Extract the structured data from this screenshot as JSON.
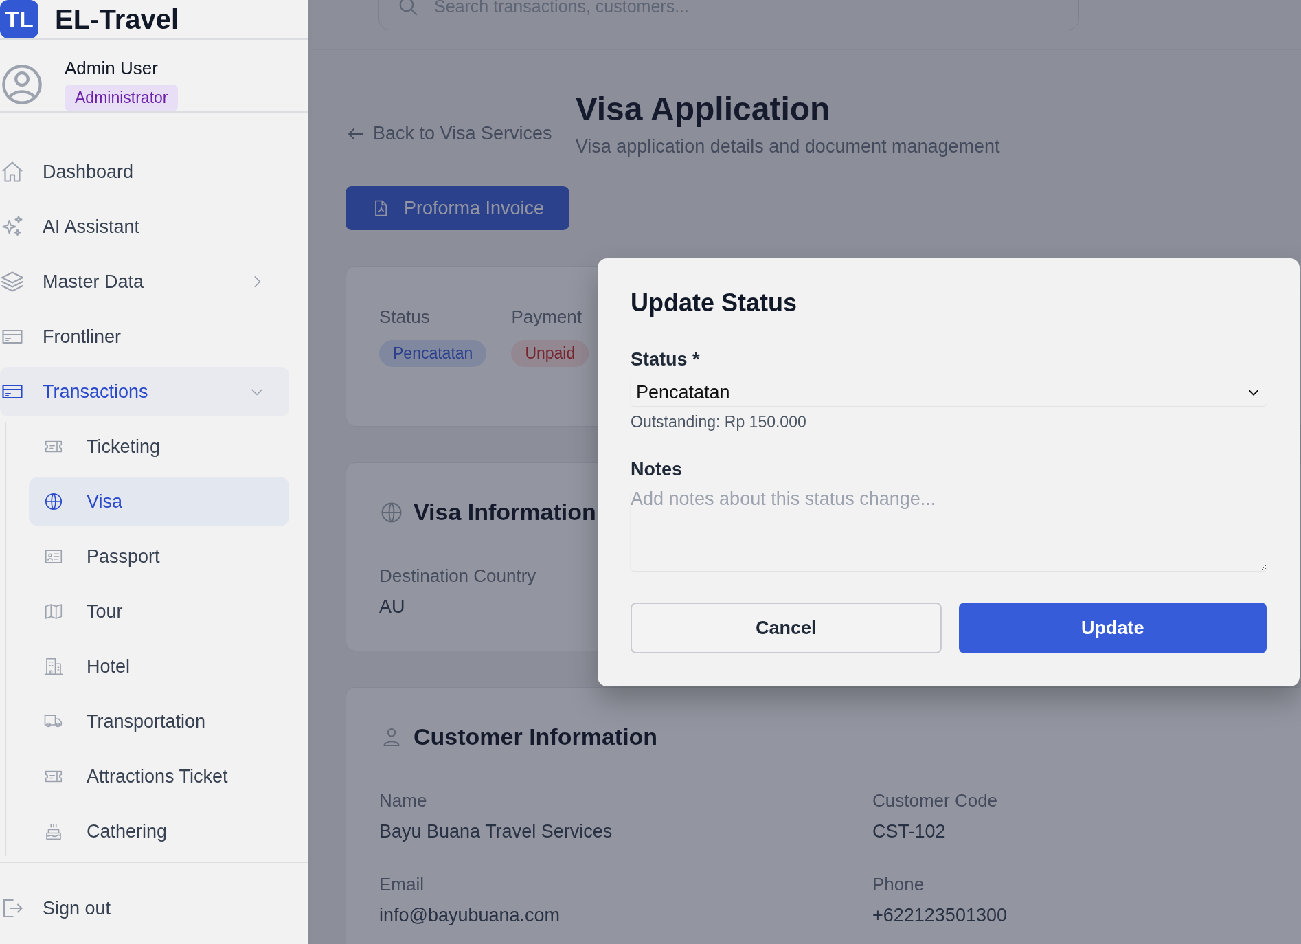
{
  "brand": {
    "logo": "TL",
    "name": "EL-Travel"
  },
  "user": {
    "name": "Admin User",
    "role": "Administrator"
  },
  "sidebar": {
    "items": [
      {
        "label": "Dashboard",
        "selected": false
      },
      {
        "label": "AI Assistant",
        "selected": false
      },
      {
        "label": "Master Data",
        "selected": false,
        "expanded": false
      },
      {
        "label": "Frontliner",
        "selected": false
      },
      {
        "label": "Transactions",
        "selected": false,
        "expanded": true,
        "children": [
          {
            "label": "Ticketing",
            "selected": false
          },
          {
            "label": "Visa",
            "selected": true
          },
          {
            "label": "Passport",
            "selected": false
          },
          {
            "label": "Tour",
            "selected": false
          },
          {
            "label": "Hotel",
            "selected": false
          },
          {
            "label": "Transportation",
            "selected": false
          },
          {
            "label": "Attractions Ticket",
            "selected": false
          },
          {
            "label": "Cathering",
            "selected": false
          }
        ]
      }
    ],
    "sign_out": "Sign out"
  },
  "search": {
    "placeholder": "Search transactions, customers..."
  },
  "page": {
    "back_link": "Back to Visa Services",
    "title": "Visa Application",
    "subtitle": "Visa application details and document management",
    "action": "Proforma Invoice",
    "badges": [
      {
        "label": "Status",
        "value": "Pencatatan",
        "kind": "info"
      },
      {
        "label": "Payment",
        "value": "Unpaid",
        "kind": "danger"
      }
    ],
    "visa_info": {
      "title": "Visa Information",
      "fields": [
        {
          "label": "Destination Country",
          "value": "AU"
        }
      ]
    },
    "customer_info": {
      "title": "Customer Information",
      "fields": [
        {
          "label": "Name",
          "value": "Bayu Buana Travel Services"
        },
        {
          "label": "Customer Code",
          "value": "CST-102"
        },
        {
          "label": "Email",
          "value": "info@bayubuana.com"
        },
        {
          "label": "Phone",
          "value": "+622123501300"
        }
      ]
    }
  },
  "dialog": {
    "title": "Update Status",
    "status_label": "Status *",
    "status_value": "Pencatatan",
    "hint": "Outstanding: Rp 150.000",
    "notes_label": "Notes",
    "notes_placeholder": "Add notes about this status change...",
    "buttons": [
      {
        "label": "Cancel",
        "kind": "secondary"
      },
      {
        "label": "Update",
        "kind": "primary"
      }
    ]
  }
}
